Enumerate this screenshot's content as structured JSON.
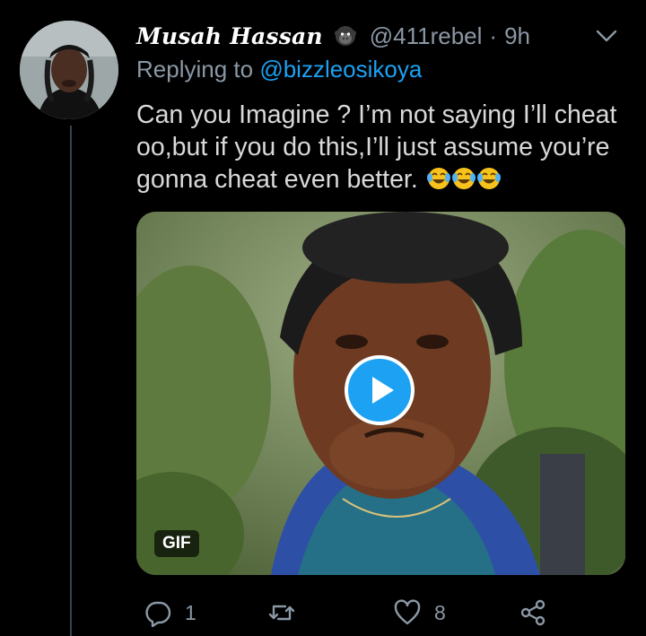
{
  "tweet": {
    "display_name": "Musah Hassan",
    "name_emoji": "gorilla-emoji",
    "handle": "@411rebel",
    "separator": "·",
    "time": "9h",
    "replying_prefix": "Replying to",
    "replying_to": "@bizzleosikoya",
    "text": "Can you Imagine ? I’m not saying I’ll cheat oo,but if you do this,I’ll just assume you’re gonna cheat even better.",
    "trailing_emoji": [
      "face-with-tears-of-joy",
      "face-with-tears-of-joy",
      "face-with-tears-of-joy"
    ],
    "media": {
      "badge": "GIF",
      "type": "gif",
      "overlay_icon": "play-icon"
    },
    "actions": {
      "reply_count": "1",
      "retweet_count": "",
      "like_count": "8"
    }
  },
  "colors": {
    "background": "#000000",
    "text": "#d9d9d9",
    "secondary": "#8b98a5",
    "accent": "#1da1f2",
    "thread_line": "#38444d"
  },
  "icons": [
    "reply-icon",
    "retweet-icon",
    "like-icon",
    "share-icon",
    "chevron-down-icon",
    "play-icon"
  ]
}
